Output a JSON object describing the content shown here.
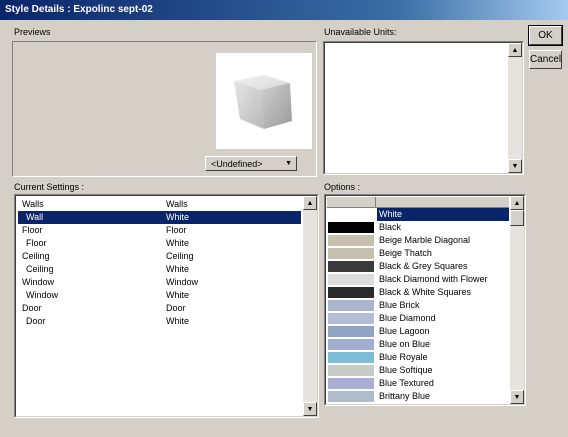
{
  "window": {
    "title": "Style Details : Expolinc sept-02"
  },
  "buttons": {
    "ok": "OK",
    "cancel": "Cancel"
  },
  "previews": {
    "label": "Previews",
    "dropdown_value": "<Undefined>"
  },
  "unavailable": {
    "label": "Unavailable Units:"
  },
  "current_settings": {
    "label": "Current Settings :",
    "rows": [
      {
        "name": "Walls",
        "value": "Walls",
        "indent": false,
        "selected": false
      },
      {
        "name": "Wall",
        "value": "White",
        "indent": true,
        "selected": true
      },
      {
        "name": "Floor",
        "value": "Floor",
        "indent": false,
        "selected": false
      },
      {
        "name": "Floor",
        "value": "White",
        "indent": true,
        "selected": false
      },
      {
        "name": "Ceiling",
        "value": "Ceiling",
        "indent": false,
        "selected": false
      },
      {
        "name": "Ceiling",
        "value": "White",
        "indent": true,
        "selected": false
      },
      {
        "name": "Window",
        "value": "Window",
        "indent": false,
        "selected": false
      },
      {
        "name": "Window",
        "value": "White",
        "indent": true,
        "selected": false
      },
      {
        "name": "Door",
        "value": "Door",
        "indent": false,
        "selected": false
      },
      {
        "name": "Door",
        "value": "White",
        "indent": true,
        "selected": false
      }
    ]
  },
  "options": {
    "label": "Options :",
    "items": [
      {
        "name": "White",
        "color": "#ffffff",
        "selected": true
      },
      {
        "name": "Black",
        "color": "#000000",
        "selected": false
      },
      {
        "name": "Beige Marble Diagonal",
        "color": "#c8c0ae",
        "selected": false
      },
      {
        "name": "Beige Thatch",
        "color": "#c6bfae",
        "selected": false
      },
      {
        "name": "Black & Grey Squares",
        "color": "#3a3a3a",
        "selected": false
      },
      {
        "name": "Black Diamond with Flower",
        "color": "#dcdcdc",
        "selected": false
      },
      {
        "name": "Black & White Squares",
        "color": "#2a2a2a",
        "selected": false
      },
      {
        "name": "Blue Brick",
        "color": "#a9b4cf",
        "selected": false
      },
      {
        "name": "Blue Diamond",
        "color": "#b4bcd6",
        "selected": false
      },
      {
        "name": "Blue Lagoon",
        "color": "#8fa3c6",
        "selected": false
      },
      {
        "name": "Blue on Blue",
        "color": "#a1aed0",
        "selected": false
      },
      {
        "name": "Blue Royale",
        "color": "#7dbed6",
        "selected": false
      },
      {
        "name": "Blue Softique",
        "color": "#c8ccc6",
        "selected": false
      },
      {
        "name": "Blue Textured",
        "color": "#a8aed4",
        "selected": false
      },
      {
        "name": "Brittany Blue",
        "color": "#aebccb",
        "selected": false
      }
    ]
  }
}
